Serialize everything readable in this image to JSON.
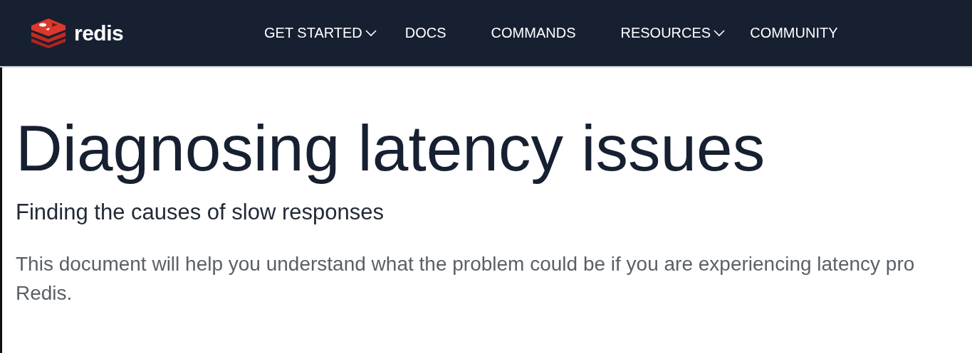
{
  "header": {
    "logo": {
      "wordmark": "redis"
    },
    "nav": [
      {
        "label": "GET STARTED",
        "dropdown": true
      },
      {
        "label": "DOCS",
        "dropdown": false
      },
      {
        "label": "COMMANDS",
        "dropdown": false
      },
      {
        "label": "RESOURCES",
        "dropdown": true
      },
      {
        "label": "COMMUNITY",
        "dropdown": false
      }
    ]
  },
  "article": {
    "title": "Diagnosing latency issues",
    "subtitle": "Finding the causes of slow responses",
    "paragraph": [
      "This document will help you understand what the problem could be if you are experiencing latency pro",
      "Redis."
    ]
  }
}
